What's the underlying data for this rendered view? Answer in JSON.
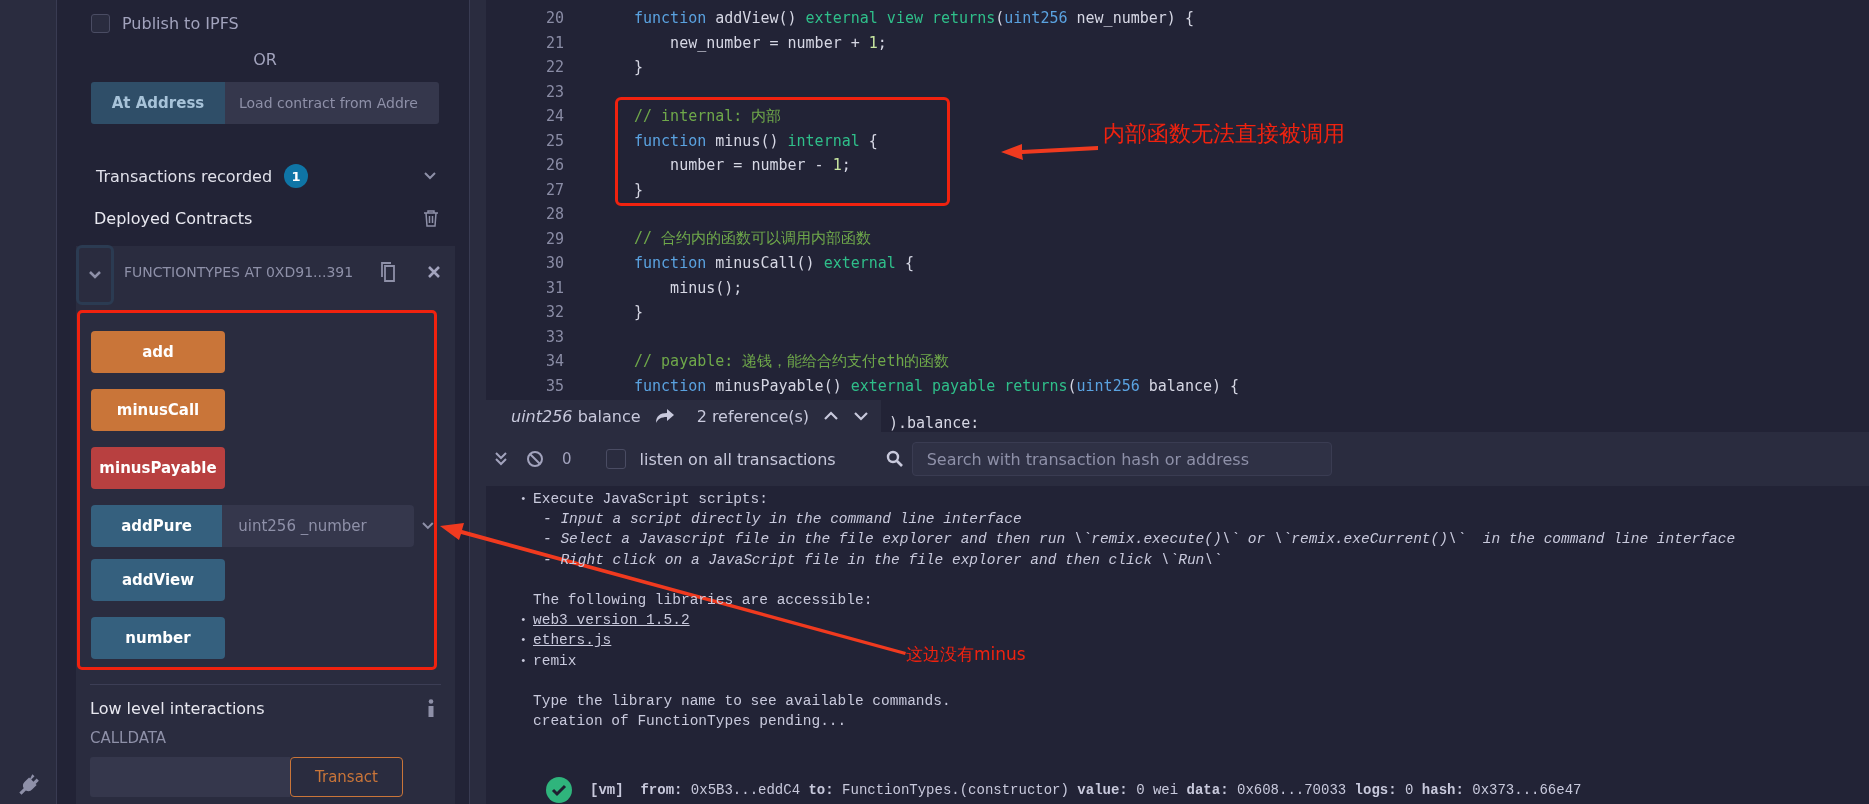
{
  "sidebar": {
    "publish": {
      "label": "Publish to IPFS",
      "checked": false
    },
    "or": "OR",
    "at_address": {
      "button": "At Address",
      "placeholder": "Load contract from Addre"
    },
    "transactions": {
      "label": "Transactions recorded",
      "badge": "1"
    },
    "deployed": "Deployed Contracts",
    "contract": {
      "title": "FUNCTIONTYPES AT 0XD91...391",
      "expanded": true
    },
    "functions": [
      {
        "label": "add",
        "kind": "transact"
      },
      {
        "label": "minusCall",
        "kind": "transact"
      },
      {
        "label": "minusPayable",
        "kind": "payable"
      },
      {
        "label": "addPure",
        "kind": "call",
        "placeholder": "uint256 _number"
      },
      {
        "label": "addView",
        "kind": "call"
      },
      {
        "label": "number",
        "kind": "call"
      }
    ],
    "low_level": {
      "title": "Low level interactions",
      "calldata": "CALLDATA",
      "button": "Transact"
    }
  },
  "editor": {
    "lines": [
      {
        "n": "20",
        "tokens": [
          {
            "text": "function ",
            "kind": "kw"
          },
          {
            "text": "addView() ",
            "kind": "p"
          },
          {
            "text": "external view returns",
            "kind": "mod"
          },
          {
            "text": "(",
            "kind": "p"
          },
          {
            "text": "uint256",
            "kind": "kw"
          },
          {
            "text": " new_number) {",
            "kind": "p"
          }
        ]
      },
      {
        "n": "21",
        "tokens": [
          {
            "text": "    new_number = number + ",
            "kind": "p"
          },
          {
            "text": "1",
            "kind": "num"
          },
          {
            "text": ";",
            "kind": "p"
          }
        ]
      },
      {
        "n": "22",
        "tokens": [
          {
            "text": "}",
            "kind": "p"
          }
        ]
      },
      {
        "n": "23"
      },
      {
        "n": "24",
        "tokens": [
          {
            "text": "// internal: 内部",
            "kind": "cm"
          }
        ]
      },
      {
        "n": "25",
        "tokens": [
          {
            "text": "function ",
            "kind": "kw"
          },
          {
            "text": "minus() ",
            "kind": "p"
          },
          {
            "text": "internal",
            "kind": "mod"
          },
          {
            "text": " {",
            "kind": "p"
          }
        ]
      },
      {
        "n": "26",
        "tokens": [
          {
            "text": "    number = number - ",
            "kind": "p"
          },
          {
            "text": "1",
            "kind": "num"
          },
          {
            "text": ";",
            "kind": "p"
          }
        ]
      },
      {
        "n": "27",
        "tokens": [
          {
            "text": "}",
            "kind": "p"
          }
        ]
      },
      {
        "n": "28"
      },
      {
        "n": "29",
        "tokens": [
          {
            "text": "// 合约内的函数可以调用内部函数",
            "kind": "cm"
          }
        ]
      },
      {
        "n": "30",
        "tokens": [
          {
            "text": "function ",
            "kind": "kw"
          },
          {
            "text": "minusCall() ",
            "kind": "p"
          },
          {
            "text": "external",
            "kind": "mod"
          },
          {
            "text": " {",
            "kind": "p"
          }
        ]
      },
      {
        "n": "31",
        "tokens": [
          {
            "text": "    minus();",
            "kind": "p"
          }
        ]
      },
      {
        "n": "32",
        "tokens": [
          {
            "text": "}",
            "kind": "p"
          }
        ]
      },
      {
        "n": "33"
      },
      {
        "n": "34",
        "tokens": [
          {
            "text": "// payable: 递钱，能给合约支付eth的函数",
            "kind": "cm"
          }
        ]
      },
      {
        "n": "35",
        "tokens": [
          {
            "text": "function ",
            "kind": "kw"
          },
          {
            "text": "minusPayable() ",
            "kind": "p"
          },
          {
            "text": "external payable returns",
            "kind": "mod"
          },
          {
            "text": "(",
            "kind": "p"
          },
          {
            "text": "uint256",
            "kind": "kw"
          },
          {
            "text": " balance) {",
            "kind": "p"
          }
        ]
      }
    ],
    "peek": {
      "type": "uint256",
      "name": "balance",
      "references": "2 reference(s)"
    },
    "tail": ").balance:"
  },
  "annotations": [
    {
      "text": "内部函数无法直接被调用"
    },
    {
      "text": "这边没有minus"
    }
  ],
  "terminal": {
    "count": "0",
    "listen": {
      "label": "listen on all transactions",
      "checked": false
    },
    "search": {
      "placeholder": "Search with transaction hash or address"
    },
    "lines": [
      {
        "kind": "bullet",
        "bullet": "•",
        "text": "Execute JavaScript scripts:"
      },
      {
        "kind": "sub",
        "text": "- Input a script directly in the command line interface"
      },
      {
        "kind": "sub",
        "text": "- Select a Javascript file in the file explorer and then run \\`remix.execute()\\` or \\`remix.exeCurrent()\\`  in the command line interface"
      },
      {
        "kind": "sub",
        "text": "- Right click on a JavaScript file in the file explorer and then click \\`Run\\`"
      },
      {
        "kind": "blank"
      },
      {
        "kind": "plain",
        "text": "The following libraries are accessible:"
      },
      {
        "kind": "link",
        "bullet": "•",
        "text": "web3 version 1.5.2"
      },
      {
        "kind": "link",
        "bullet": "•",
        "text": "ethers.js"
      },
      {
        "kind": "bullet",
        "bullet": "•",
        "text": "remix"
      },
      {
        "kind": "blank"
      },
      {
        "kind": "plain",
        "text": "Type the library name to see available commands."
      },
      {
        "kind": "plain",
        "text": "creation of FunctionTypes pending..."
      }
    ],
    "tx": {
      "kind": "success",
      "text": "**[vm]**  **from:** 0x5B3...eddC4 **to:** FunctionTypes.(constructor) **value:** 0 wei **data:** 0x608...70033 **logs:** 0 **hash:** 0x373...66e47"
    }
  }
}
